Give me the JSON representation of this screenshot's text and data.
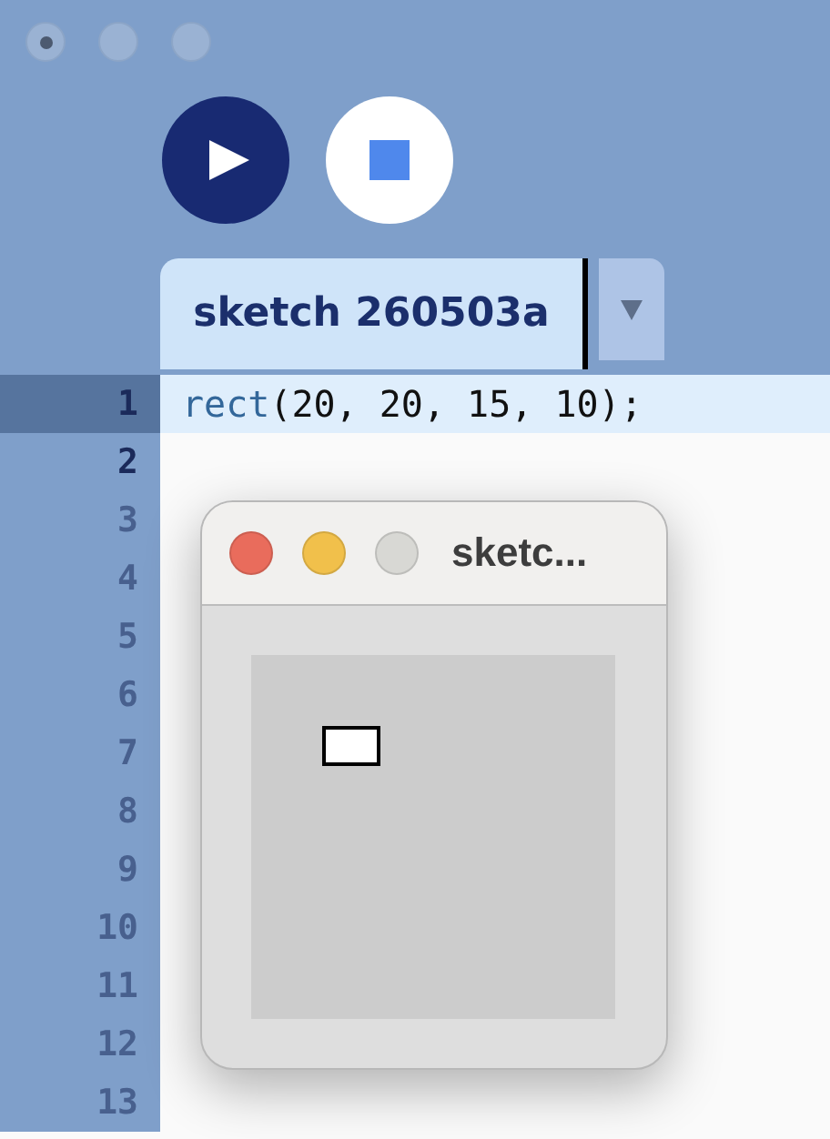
{
  "window": {
    "controls": [
      {
        "kind": "close"
      },
      {
        "kind": "minimize"
      },
      {
        "kind": "zoom"
      }
    ]
  },
  "toolbar": {
    "buttons": [
      {
        "kind": "run"
      },
      {
        "kind": "stop"
      }
    ]
  },
  "tabs": [
    {
      "label": "sketch 260503a",
      "selected": true
    }
  ],
  "editor": {
    "lines": [
      {
        "number": "1",
        "selected": true,
        "dim": false,
        "tokens": [
          {
            "kind": "function",
            "text": "rect"
          },
          {
            "kind": "plain",
            "text": "(20, 20, 15, 10);"
          }
        ]
      },
      {
        "number": "2",
        "selected": false,
        "dim": false
      },
      {
        "number": "3",
        "selected": false,
        "dim": true
      },
      {
        "number": "4",
        "selected": false,
        "dim": true
      },
      {
        "number": "5",
        "selected": false,
        "dim": true
      },
      {
        "number": "6",
        "selected": false,
        "dim": true
      },
      {
        "number": "7",
        "selected": false,
        "dim": true
      },
      {
        "number": "8",
        "selected": false,
        "dim": true
      },
      {
        "number": "9",
        "selected": false,
        "dim": true
      },
      {
        "number": "10",
        "selected": false,
        "dim": true
      },
      {
        "number": "11",
        "selected": false,
        "dim": true
      },
      {
        "number": "12",
        "selected": false,
        "dim": true
      },
      {
        "number": "13",
        "selected": false,
        "dim": true
      }
    ]
  },
  "sketch_window": {
    "title": "sketc...",
    "controls": [
      {
        "color": "#e96c5c"
      },
      {
        "color": "#f1c04b"
      },
      {
        "color": "#d8d8d4"
      }
    ]
  }
}
